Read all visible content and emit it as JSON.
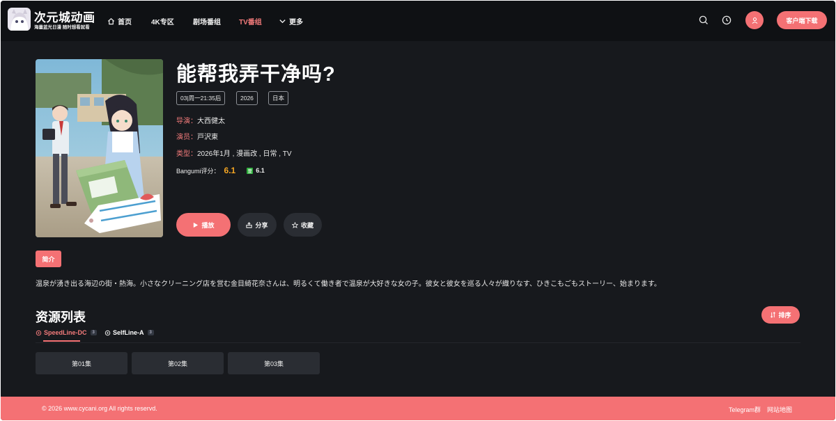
{
  "header": {
    "brand_name": "次元城动画",
    "brand_slogan": "海量蓝光日漫 随时想看就看",
    "nav": [
      {
        "label": "首页",
        "icon": "home-icon"
      },
      {
        "label": "4K专区"
      },
      {
        "label": "剧场番组"
      },
      {
        "label": "TV番组",
        "active": true
      },
      {
        "label": "更多",
        "icon": "chevron-down-icon"
      }
    ],
    "download_label": "客户端下载"
  },
  "detail": {
    "title": "能帮我弄干净吗?",
    "tags": [
      "03|周一21:35后",
      "2026",
      "日本"
    ],
    "director_key": "导演：",
    "director": "大西健太",
    "cast_key": "演员：",
    "cast": "戸沢東",
    "genre_key": "类型：",
    "genre": "2026年1月 , 漫画改 , 日常 , TV",
    "rating_label": "Bangumi评分：",
    "rating_value": "6.1",
    "douban_value": "6.1",
    "play_label": "播放",
    "share_label": "分享",
    "fav_label": "收藏"
  },
  "intro": {
    "badge": "简介",
    "text": "温泉が湧き出る海辺の街・熱海。小さなクリーニング店を営む金目綺花奈さんは、明るくて働き者で温泉が大好きな女の子。彼女と彼女を巡る人々が織りなす、ひきこもごもストーリー、始まります。"
  },
  "resources": {
    "title": "资源列表",
    "sort_label": "排序",
    "lines": [
      {
        "label": "SpeedLine-DC",
        "count": "3",
        "active": true
      },
      {
        "label": "SelfLine-A",
        "count": "3"
      }
    ],
    "episodes": [
      "第01集",
      "第02集",
      "第03集"
    ]
  },
  "footer": {
    "copyright": "© 2026 www.cycani.org All rights reservd.",
    "links": [
      "Telegram群",
      "网站地图"
    ]
  },
  "colors": {
    "accent": "#f47174",
    "background": "#17191d",
    "header": "#0f1114",
    "rating": "#f5a623"
  }
}
